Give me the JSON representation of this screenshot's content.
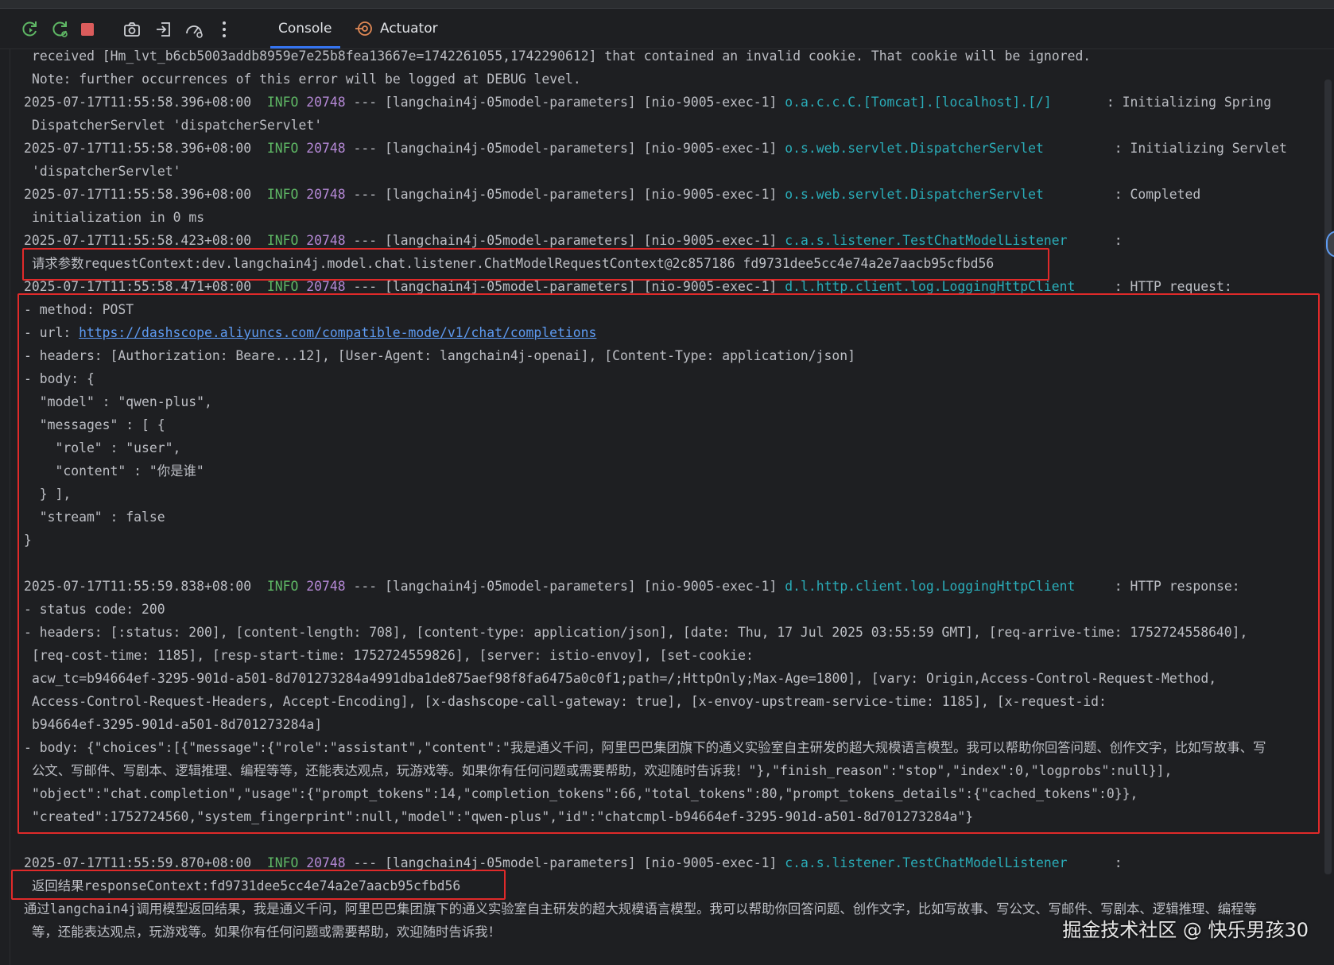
{
  "toolbar": {
    "buttons": [
      {
        "name": "rerun-icon",
        "color": "#5fb865"
      },
      {
        "name": "restart-icon",
        "color": "#5fb865"
      },
      {
        "name": "stop-icon",
        "color": "#db5c5c"
      },
      {
        "name": "camera-icon",
        "color": "#cfd1d6"
      },
      {
        "name": "login-icon",
        "color": "#cfd1d6"
      },
      {
        "name": "gauge-icon",
        "color": "#cfd1d6"
      },
      {
        "name": "more-icon",
        "color": "#cfd1d6"
      }
    ],
    "tabs": [
      {
        "label": "Console",
        "active": true
      },
      {
        "label": "Actuator",
        "active": false
      }
    ]
  },
  "console": {
    "l1": "received [Hm_lvt_b6cb5003addb8959e7e25b8fea13667e=1742261055,1742290612] that contained an invalid cookie. That cookie will be ignored.",
    "l2": "Note: further occurrences of this error will be logged at DEBUG level.",
    "entries": [
      {
        "time": "2025-07-17T11:55:58.396+08:00",
        "level": "INFO",
        "pid": "20748",
        "app": "--- [langchain4j-05model-parameters] [nio-9005-exec-1]",
        "logger": "o.a.c.c.C.[Tomcat].[localhost].[/]",
        "msg": ": Initializing Spring"
      },
      {
        "time": "2025-07-17T11:55:58.396+08:00",
        "level": "INFO",
        "pid": "20748",
        "app": "--- [langchain4j-05model-parameters] [nio-9005-exec-1]",
        "logger": "o.s.web.servlet.DispatcherServlet",
        "msg": ": Initializing Servlet"
      },
      {
        "time": "2025-07-17T11:55:58.396+08:00",
        "level": "INFO",
        "pid": "20748",
        "app": "--- [langchain4j-05model-parameters] [nio-9005-exec-1]",
        "logger": "o.s.web.servlet.DispatcherServlet",
        "msg": ": Completed"
      },
      {
        "time": "2025-07-17T11:55:58.423+08:00",
        "level": "INFO",
        "pid": "20748",
        "app": "--- [langchain4j-05model-parameters] [nio-9005-exec-1]",
        "logger": "c.a.s.listener.TestChatModelListener",
        "msg": ":"
      },
      {
        "time": "2025-07-17T11:55:58.471+08:00",
        "level": "INFO",
        "pid": "20748",
        "app": "--- [langchain4j-05model-parameters] [nio-9005-exec-1]",
        "logger": "d.l.http.client.log.LoggingHttpClient",
        "msg": ": HTTP request:"
      },
      {
        "time": "2025-07-17T11:55:59.838+08:00",
        "level": "INFO",
        "pid": "20748",
        "app": "--- [langchain4j-05model-parameters] [nio-9005-exec-1]",
        "logger": "d.l.http.client.log.LoggingHttpClient",
        "msg": ": HTTP response:"
      },
      {
        "time": "2025-07-17T11:55:59.870+08:00",
        "level": "INFO",
        "pid": "20748",
        "app": "--- [langchain4j-05model-parameters] [nio-9005-exec-1]",
        "logger": "c.a.s.listener.TestChatModelListener",
        "msg": ":"
      }
    ],
    "cont1": "DispatcherServlet 'dispatcherServlet'",
    "cont2": "'dispatcherServlet'",
    "cont3": "initialization in 0 ms",
    "req_ctx": "请求参数requestContext:dev.langchain4j.model.chat.listener.ChatModelRequestContext@2c857186 fd9731dee5cc4e74a2e7aacb95cfbd56",
    "req_method": "- method: POST",
    "req_url_prefix": "- url: ",
    "req_url": "https://dashscope.aliyuncs.com/compatible-mode/v1/chat/completions",
    "req_headers": "- headers: [Authorization: Beare...12], [User-Agent: langchain4j-openai], [Content-Type: application/json]",
    "req_body_open": "- body: {",
    "req_model": "  \"model\" : \"qwen-plus\",",
    "req_messages": "  \"messages\" : [ {",
    "req_role": "    \"role\" : \"user\",",
    "req_content": "    \"content\" : \"你是谁\"",
    "req_msg_close": "  } ],",
    "req_stream": "  \"stream\" : false",
    "req_body_close": "}",
    "resp_status": "- status code: 200",
    "resp_h1": "- headers: [:status: 200], [content-length: 708], [content-type: application/json], [date: Thu, 17 Jul 2025 03:55:59 GMT], [req-arrive-time: 1752724558640],",
    "resp_h2": "[req-cost-time: 1185], [resp-start-time: 1752724559826], [server: istio-envoy], [set-cookie:",
    "resp_h3": "acw_tc=b94664ef-3295-901d-a501-8d701273284a4991dba1de875aef98f8fa6475a0c0f1;path=/;HttpOnly;Max-Age=1800], [vary: Origin,Access-Control-Request-Method,",
    "resp_h4": "Access-Control-Request-Headers, Accept-Encoding], [x-dashscope-call-gateway: true], [x-envoy-upstream-service-time: 1185], [x-request-id:",
    "resp_h5": "b94664ef-3295-901d-a501-8d701273284a]",
    "resp_b1": "- body: {\"choices\":[{\"message\":{\"role\":\"assistant\",\"content\":\"我是通义千问，阿里巴巴集团旗下的通义实验室自主研发的超大规模语言模型。我可以帮助你回答问题、创作文字，比如写故事、写",
    "resp_b2": "公文、写邮件、写剧本、逻辑推理、编程等等，还能表达观点，玩游戏等。如果你有任何问题或需要帮助，欢迎随时告诉我！\"},\"finish_reason\":\"stop\",\"index\":0,\"logprobs\":null}],",
    "resp_b3": "\"object\":\"chat.completion\",\"usage\":{\"prompt_tokens\":14,\"completion_tokens\":66,\"total_tokens\":80,\"prompt_tokens_details\":{\"cached_tokens\":0}},",
    "resp_b4": "\"created\":1752724560,\"system_fingerprint\":null,\"model\":\"qwen-plus\",\"id\":\"chatcmpl-b94664ef-3295-901d-a501-8d701273284a\"}",
    "resp_ctx": "返回结果responseContext:fd9731dee5cc4e74a2e7aacb95cfbd56",
    "final1": "通过langchain4j调用模型返回结果，我是通义千问，阿里巴巴集团旗下的通义实验室自主研发的超大规模语言模型。我可以帮助你回答问题、创作文字，比如写故事、写公文、写邮件、写剧本、逻辑推理、编程等",
    "final2": "等，还能表达观点，玩游戏等。如果你有任何问题或需要帮助，欢迎随时告诉我！"
  },
  "watermark": "掘金技术社区 @ 快乐男孩30"
}
